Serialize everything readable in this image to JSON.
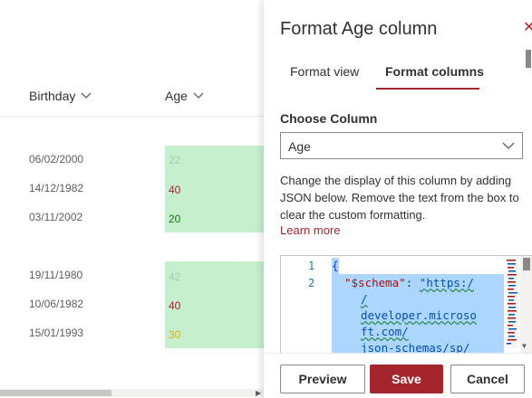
{
  "list": {
    "columns": [
      {
        "label": "Birthday"
      },
      {
        "label": "Age"
      }
    ],
    "group1": [
      {
        "date": "06/02/2000",
        "age": "22",
        "age_color": "#a7d1a9"
      },
      {
        "date": "14/12/1982",
        "age": "40",
        "age_color": "#a4262c"
      },
      {
        "date": "03/11/2002",
        "age": "20",
        "age_color": "#107c10"
      }
    ],
    "group2": [
      {
        "date": "19/11/1980",
        "age": "42",
        "age_color": "#a7d1a9"
      },
      {
        "date": "10/06/1982",
        "age": "40",
        "age_color": "#a4262c"
      },
      {
        "date": "15/01/1993",
        "age": "30",
        "age_color": "#e8b100"
      }
    ],
    "highlight_color": "#c6efce"
  },
  "panel": {
    "title": "Format Age column",
    "close_icon": "close-icon",
    "tabs": [
      {
        "label": "Format view"
      },
      {
        "label": "Format columns",
        "selected": true
      }
    ],
    "choose_column_label": "Choose Column",
    "selected_column": "Age",
    "description": "Change the display of this column by adding JSON below. Remove the text from the box to clear the custom formatting.",
    "learn_more": "Learn more",
    "editor": {
      "line_numbers": [
        "1",
        "2"
      ],
      "line1": "{",
      "schema_key": "\"$schema\"",
      "colon": ": ",
      "url_parts": [
        "\"https:/",
        "/",
        "developer.microso",
        "ft.com/",
        "json-schemas/sp/"
      ]
    },
    "buttons": {
      "preview": "Preview",
      "save": "Save",
      "cancel": "Cancel"
    },
    "accent_color": "#a4262c"
  }
}
